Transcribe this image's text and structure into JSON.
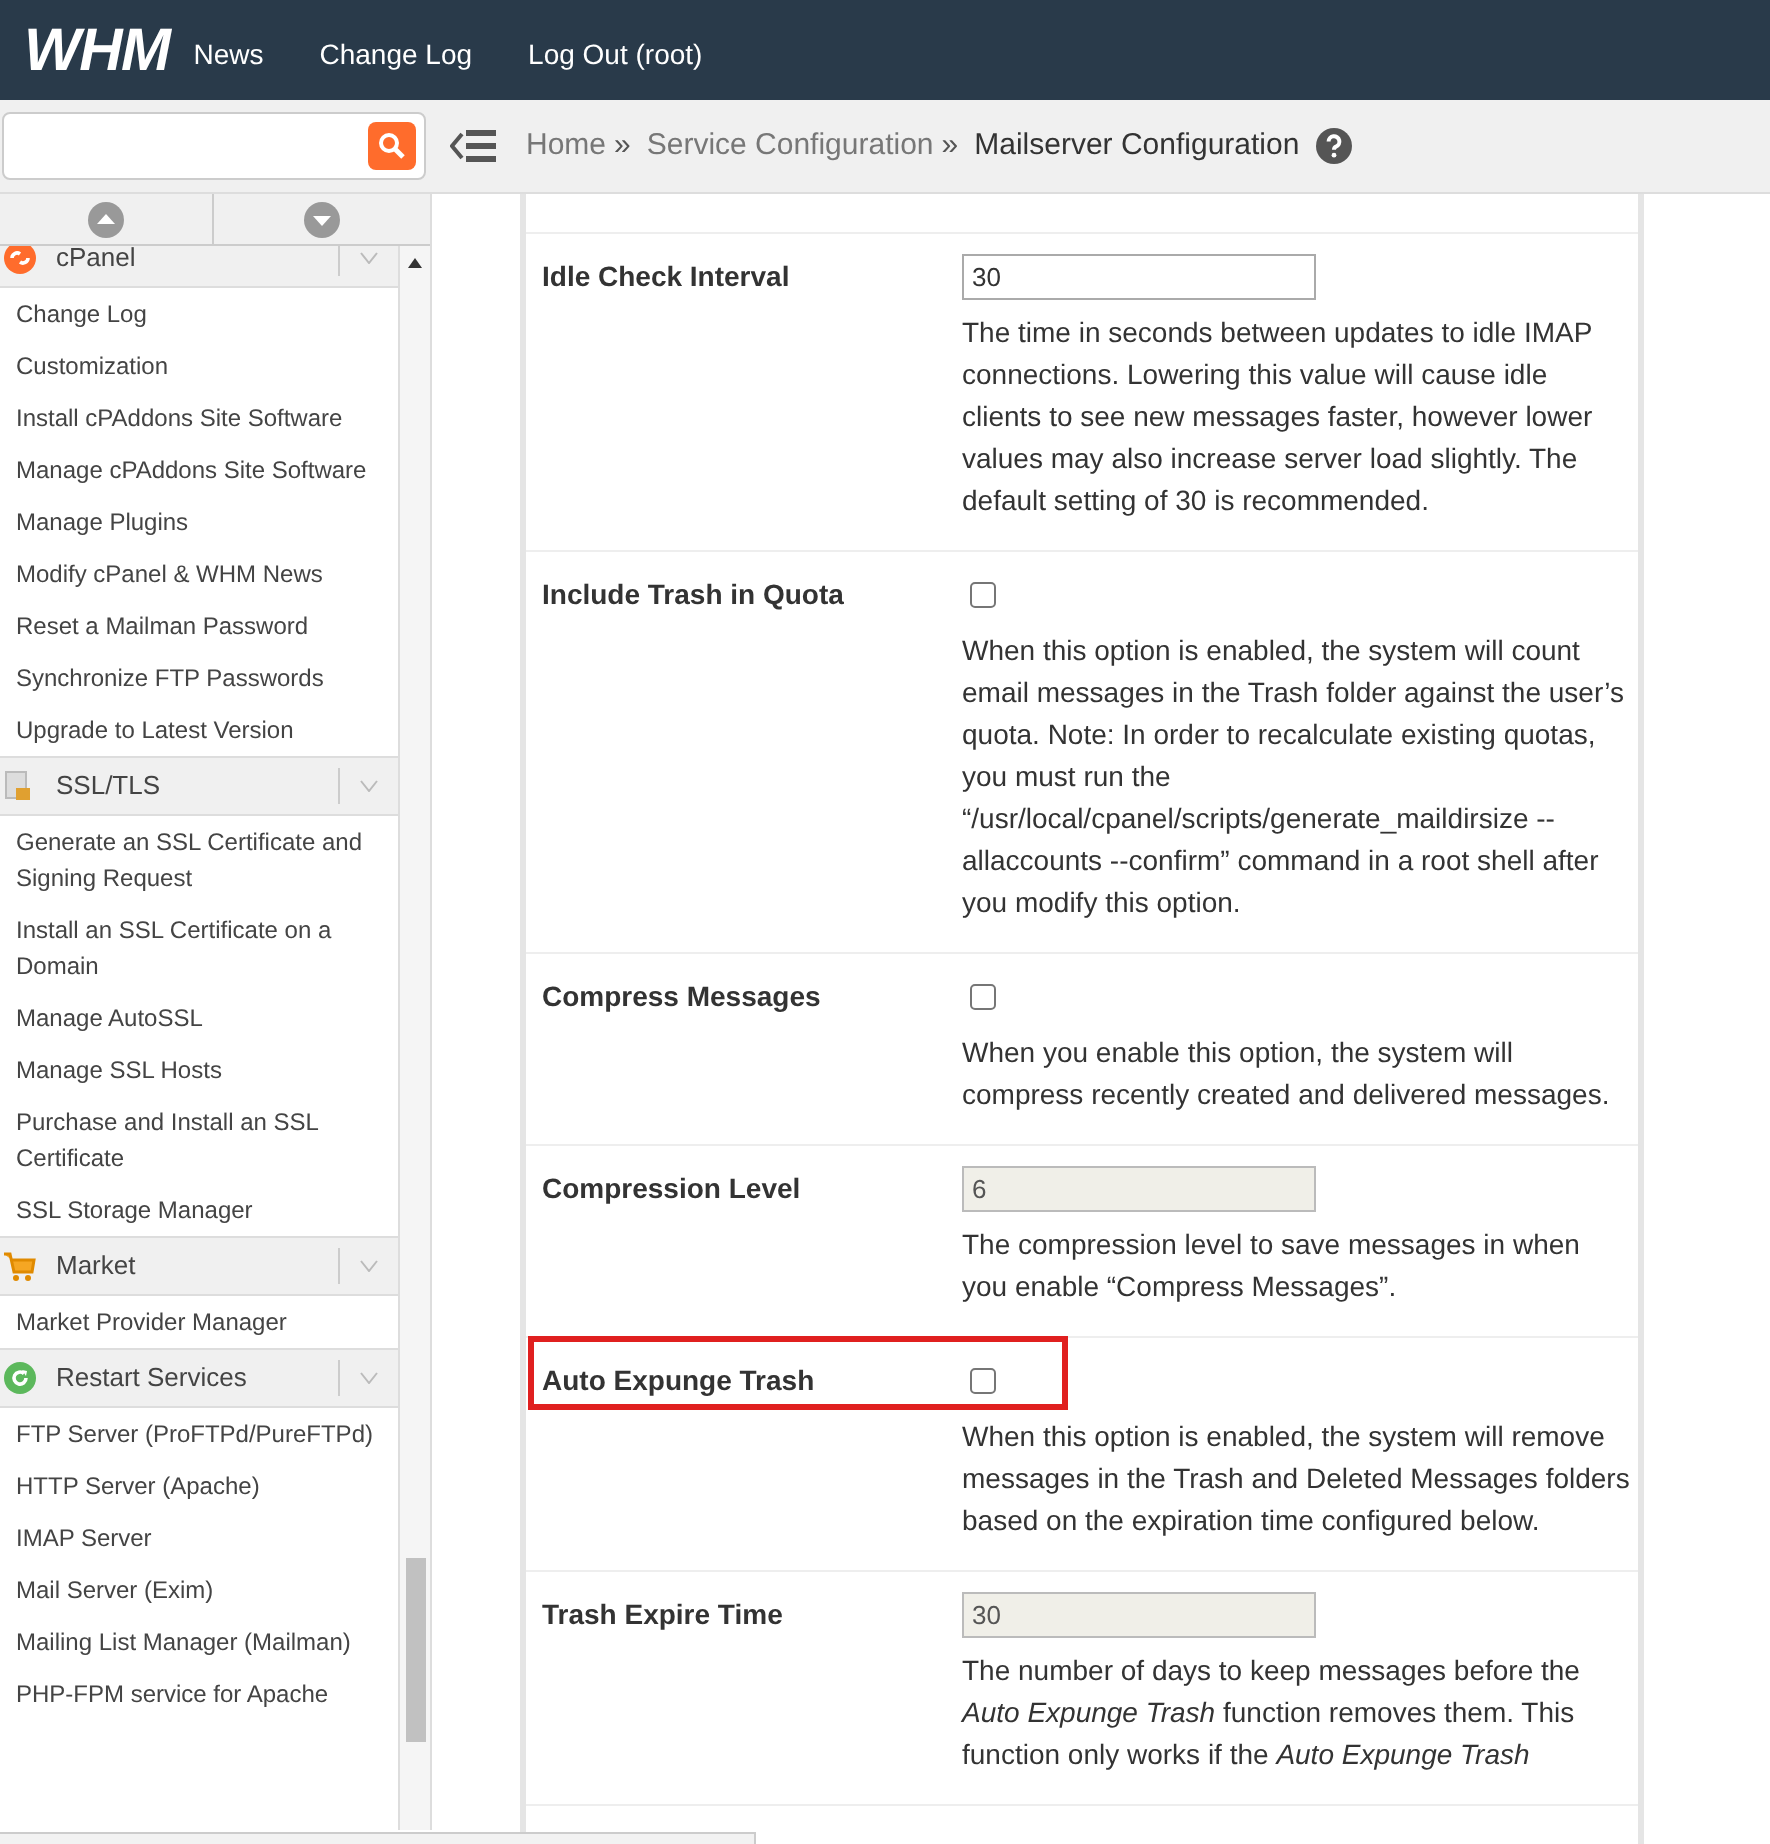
{
  "header": {
    "logo": "WHM",
    "links": [
      "News",
      "Change Log",
      "Log Out (root)"
    ]
  },
  "breadcrumb": [
    "Home",
    "Service Configuration",
    "Mailserver Configuration"
  ],
  "breadcrumb_separator": "»",
  "sidebar": {
    "groups": [
      {
        "title": "cPanel",
        "items": [
          "Change Log",
          "Customization",
          "Install cPAddons Site Software",
          "Manage cPAddons Site Software",
          "Manage Plugins",
          "Modify cPanel & WHM News",
          "Reset a Mailman Password",
          "Synchronize FTP Passwords",
          "Upgrade to Latest Version"
        ]
      },
      {
        "title": "SSL/TLS",
        "items": [
          "Generate an SSL Certificate and Signing Request",
          "Install an SSL Certificate on a Domain",
          "Manage AutoSSL",
          "Manage SSL Hosts",
          "Purchase and Install an SSL Certificate",
          "SSL Storage Manager"
        ]
      },
      {
        "title": "Market",
        "items": [
          "Market Provider Manager"
        ]
      },
      {
        "title": "Restart Services",
        "items": [
          "FTP Server (ProFTPd/PureFTPd)",
          "HTTP Server (Apache)",
          "IMAP Server",
          "Mail Server (Exim)",
          "Mailing List Manager (Mailman)",
          "PHP-FPM service for Apache"
        ]
      }
    ]
  },
  "settings": [
    {
      "label": "Idle Check Interval",
      "kind": "text",
      "value": "30",
      "disabled": false,
      "highlighted": false,
      "description": "The time in seconds between updates to idle IMAP connections. Lowering this value will cause idle clients to see new messages faster, however lower values may also increase server load slightly. The default setting of 30 is recommended."
    },
    {
      "label": "Include Trash in Quota",
      "kind": "checkbox",
      "checked": false,
      "highlighted": false,
      "description": "When this option is enabled, the system will count email messages in the Trash folder against the user’s quota. Note: In order to recalculate existing quotas, you must run the “/usr/local/cpanel/scripts/generate_maildirsize --allaccounts --confirm” command in a root shell after you modify this option."
    },
    {
      "label": "Compress Messages",
      "kind": "checkbox",
      "checked": false,
      "highlighted": false,
      "description": "When you enable this option, the system will compress recently created and delivered messages."
    },
    {
      "label": "Compression Level",
      "kind": "text",
      "value": "6",
      "disabled": true,
      "highlighted": false,
      "description": "The compression level to save messages in when you enable “Compress Messages”."
    },
    {
      "label": "Auto Expunge Trash",
      "kind": "checkbox",
      "checked": false,
      "highlighted": true,
      "description": "When this option is enabled, the system will remove messages in the Trash and Deleted Messages folders based on the expiration time configured below."
    },
    {
      "label": "Trash Expire Time",
      "kind": "text",
      "value": "30",
      "disabled": true,
      "highlighted": false,
      "description": "The number of days to keep messages before the *Auto Expunge Trash* function removes them. This function only works if the *Auto Expunge Trash*"
    }
  ]
}
